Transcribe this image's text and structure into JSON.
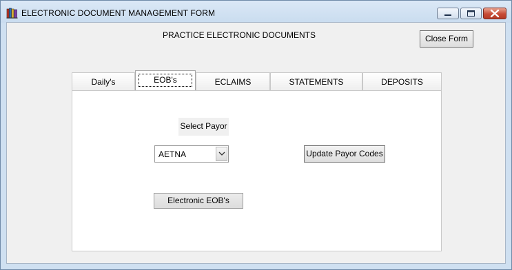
{
  "window": {
    "title": "ELECTRONIC DOCUMENT MANAGEMENT FORM",
    "app_icon": "books-app-icon",
    "controls": [
      "minimize-icon",
      "maximize-icon",
      "close-icon"
    ]
  },
  "header": {
    "heading": "PRACTICE ELECTRONIC DOCUMENTS",
    "close_form_label": "Close Form"
  },
  "tabs": [
    {
      "label": "Daily's",
      "selected": false
    },
    {
      "label": "EOB's",
      "selected": true
    },
    {
      "label": "ECLAIMS",
      "selected": false
    },
    {
      "label": "STATEMENTS",
      "selected": false
    },
    {
      "label": "DEPOSITS",
      "selected": false
    }
  ],
  "eob_panel": {
    "select_payor_label": "Select Payor",
    "payor_value": "AETNA",
    "update_payor_codes_label": "Update Payor Codes",
    "electronic_eobs_label": "Electronic EOB's"
  },
  "colors": {
    "title_bar": "#cfe0f1",
    "close_button": "#c74b36",
    "client_background": "#f0f0f0",
    "tab_panel": "#ffffff"
  }
}
